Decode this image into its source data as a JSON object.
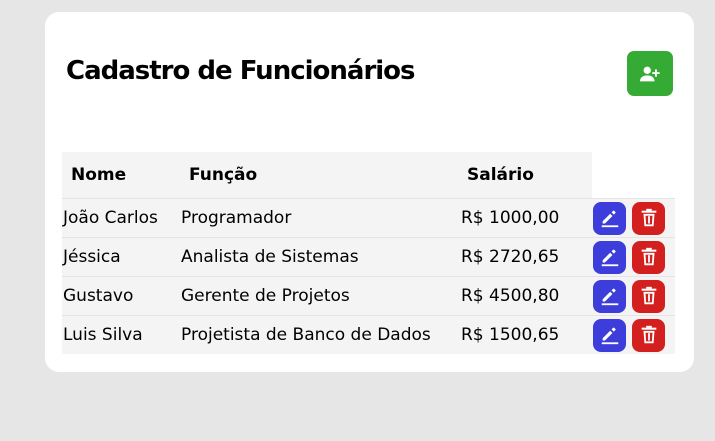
{
  "page": {
    "title": "Cadastro de Funcionários"
  },
  "colors": {
    "add_button": "#35aa34",
    "edit_button": "#3d3ddb",
    "delete_button": "#d3201f"
  },
  "icons": {
    "add": "add-user-icon",
    "edit": "pencil-icon",
    "delete": "trash-icon"
  },
  "table": {
    "headers": {
      "nome": "Nome",
      "funcao": "Função",
      "salario": "Salário"
    },
    "rows": [
      {
        "nome": "João Carlos",
        "funcao": "Programador",
        "salario": "R$ 1000,00"
      },
      {
        "nome": "Jéssica",
        "funcao": "Analista de Sistemas",
        "salario": "R$ 2720,65"
      },
      {
        "nome": "Gustavo",
        "funcao": "Gerente de Projetos",
        "salario": "R$ 4500,80"
      },
      {
        "nome": "Luis Silva",
        "funcao": "Projetista de Banco de Dados",
        "salario": "R$ 1500,65"
      }
    ]
  }
}
